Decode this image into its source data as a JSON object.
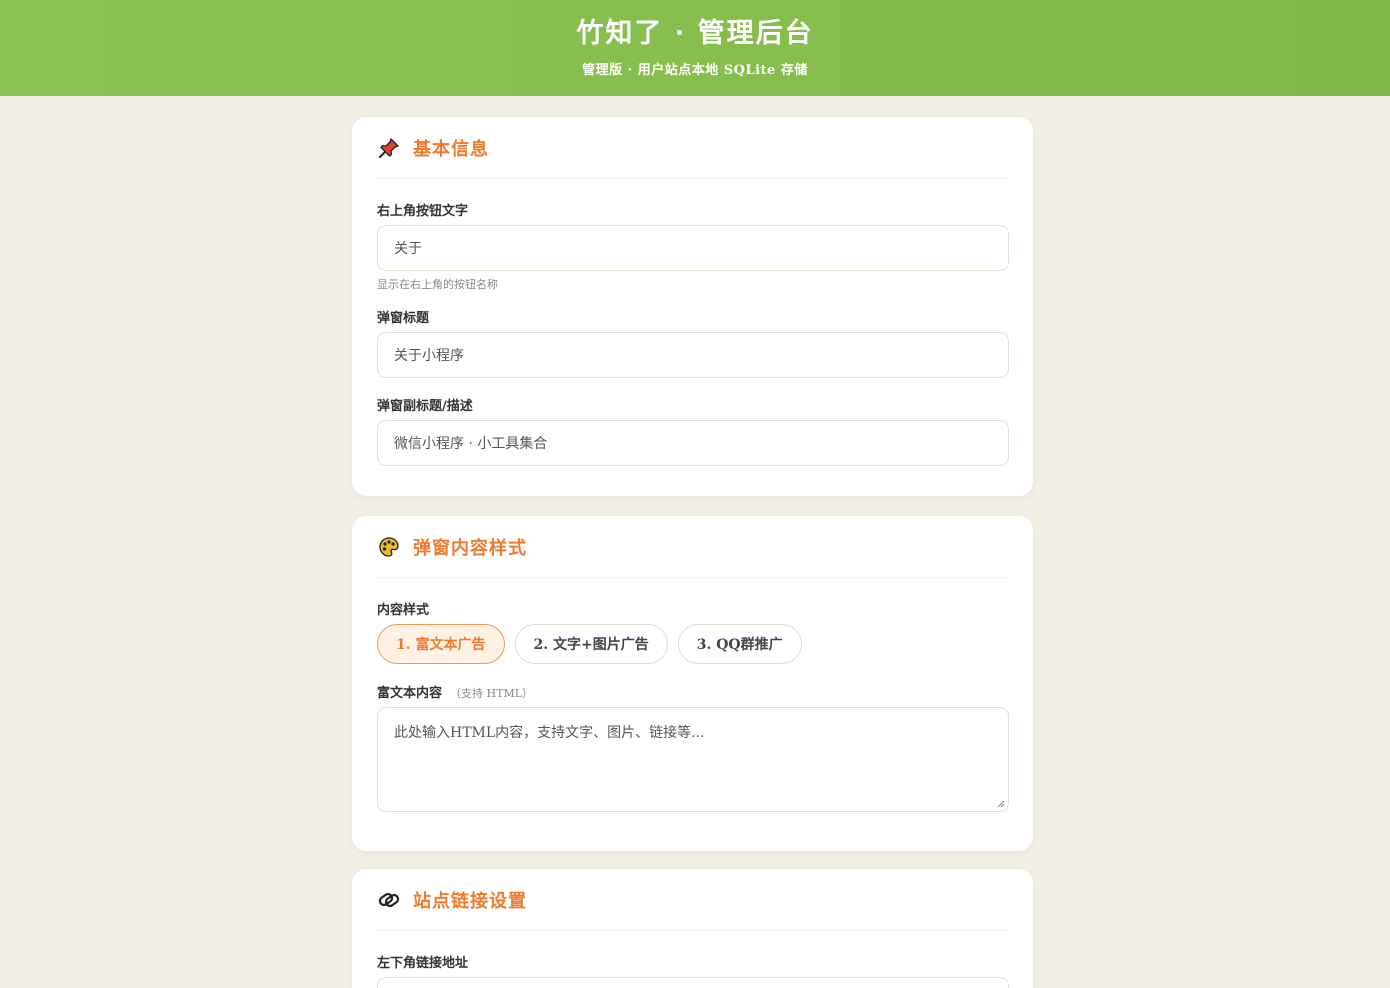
{
  "header": {
    "title": "竹知了 · 管理后台",
    "subtitle": "管理版 · 用户站点本地 SQLite 存储"
  },
  "basic": {
    "title": "基本信息",
    "icon": "pushpin-icon",
    "button_text_label": "右上角按钮文字",
    "button_text_value": "关于",
    "button_text_hint": "显示在右上角的按钮名称",
    "popup_title_label": "弹窗标题",
    "popup_title_value": "关于小程序",
    "popup_subtitle_label": "弹窗副标题/描述",
    "popup_subtitle_value": "微信小程序 · 小工具集合"
  },
  "style": {
    "title": "弹窗内容样式",
    "icon": "palette-icon",
    "content_style_label": "内容样式",
    "options": [
      "1. 富文本广告",
      "2. 文字+图片广告",
      "3. QQ群推广"
    ],
    "selected_index": 0,
    "rich_label": "富文本内容",
    "rich_label_note": "（支持 HTML）",
    "rich_placeholder": "此处输入HTML内容，支持文字、图片、链接等..."
  },
  "links": {
    "title": "站点链接设置",
    "icon": "link-icon",
    "bottom_left_label": "左下角链接地址"
  },
  "colors": {
    "header_green": "#86bc4d",
    "accent_orange": "#ef7b2e",
    "page_bg": "#f3efe5"
  }
}
